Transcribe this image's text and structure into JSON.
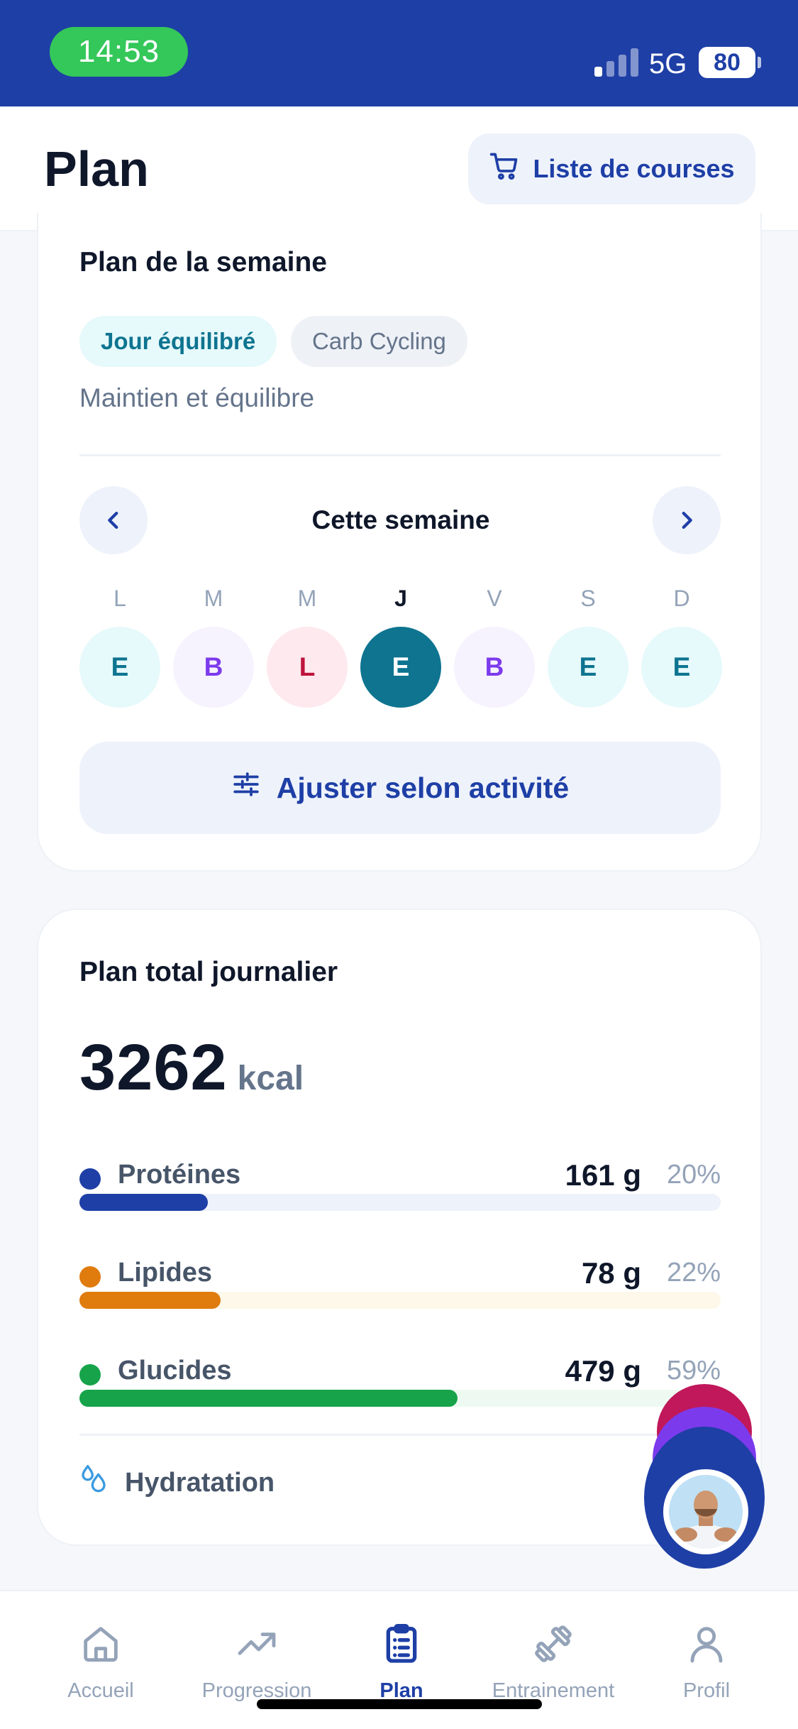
{
  "status_bar": {
    "time": "14:53",
    "network": "5G",
    "battery": "80"
  },
  "header": {
    "title": "Plan",
    "shopping_list_label": "Liste de courses"
  },
  "week_plan": {
    "title": "Plan de la semaine",
    "chips": [
      "Jour équilibré",
      "Carb Cycling"
    ],
    "subtitle": "Maintien et équilibre",
    "week_label": "Cette semaine",
    "days": [
      {
        "letter": "L",
        "type": "E"
      },
      {
        "letter": "M",
        "type": "B"
      },
      {
        "letter": "M",
        "type": "L"
      },
      {
        "letter": "J",
        "type": "E",
        "selected": true
      },
      {
        "letter": "V",
        "type": "B"
      },
      {
        "letter": "S",
        "type": "E"
      },
      {
        "letter": "D",
        "type": "E"
      }
    ],
    "adjust_label": "Ajuster selon activité"
  },
  "daily_total": {
    "title": "Plan total journalier",
    "kcal": "3262",
    "kcal_unit": "kcal",
    "macros": [
      {
        "name": "Protéines",
        "grams": "161 g",
        "percent": "20%",
        "color": "#1e3fa6",
        "track": "#eef2fb",
        "fill": 0.2
      },
      {
        "name": "Lipides",
        "grams": "78 g",
        "percent": "22%",
        "color": "#e07b0d",
        "track": "#fdf8e9",
        "fill": 0.22
      },
      {
        "name": "Glucides",
        "grams": "479 g",
        "percent": "59%",
        "color": "#16a34a",
        "track": "#eefaf1",
        "fill": 0.59
      }
    ],
    "hydration_label": "Hydratation"
  },
  "tabs": [
    {
      "label": "Accueil",
      "icon": "home-icon"
    },
    {
      "label": "Progression",
      "icon": "trend-icon"
    },
    {
      "label": "Plan",
      "icon": "clipboard-icon",
      "active": true
    },
    {
      "label": "Entrainement",
      "icon": "dumbbell-icon"
    },
    {
      "label": "Profil",
      "icon": "user-icon"
    }
  ],
  "colors": {
    "brand": "#1e3fa6",
    "accent": "#0e7490",
    "status_time": "#34c759"
  }
}
